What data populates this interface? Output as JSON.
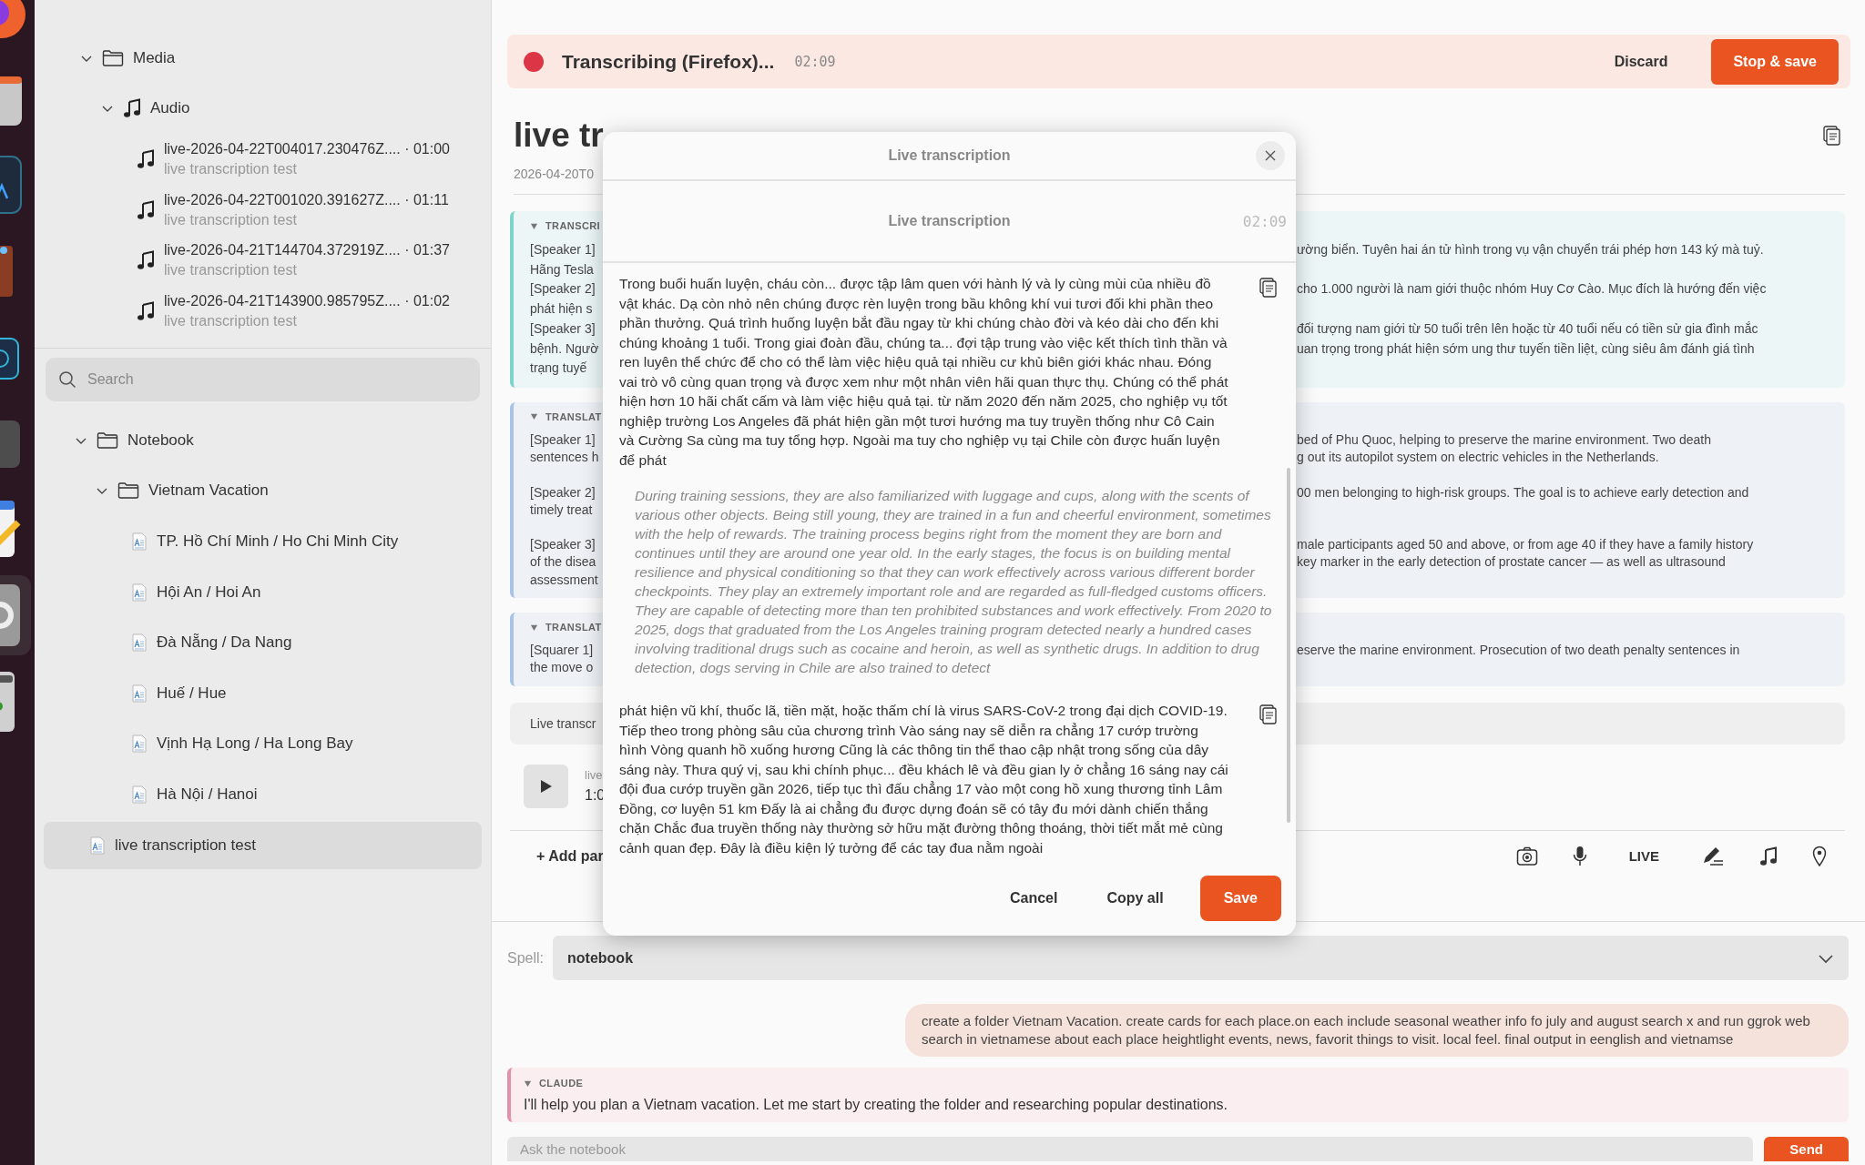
{
  "sidebar": {
    "media": [
      {
        "kind": "folder",
        "label": "Media",
        "expanded": true,
        "selected": false,
        "children": [
          {
            "kind": "audio_folder",
            "label": "Audio",
            "expanded": true,
            "selected": false,
            "children": [
              {
                "kind": "audio",
                "label": "live-2026-04-22T004017.230476Z.... · 01:00",
                "subtitle": "live transcription test",
                "selected": false
              },
              {
                "kind": "audio",
                "label": "live-2026-04-22T001020.391627Z.... · 01:11",
                "subtitle": "live transcription test",
                "selected": false
              },
              {
                "kind": "audio",
                "label": "live-2026-04-21T144704.372919Z.... · 01:37",
                "subtitle": "live transcription test",
                "selected": false
              },
              {
                "kind": "audio",
                "label": "live-2026-04-21T143900.985795Z.... · 01:02",
                "subtitle": "live transcription test",
                "selected": false
              }
            ]
          }
        ]
      }
    ],
    "search": {
      "placeholder": "Search"
    },
    "notes": [
      {
        "kind": "folder",
        "label": "Notebook",
        "expanded": true,
        "selected": false,
        "children": [
          {
            "kind": "folder",
            "label": "Vietnam Vacation",
            "expanded": true,
            "selected": false,
            "children": [
              {
                "kind": "note",
                "label": "TP. Hồ Chí Minh / Ho Chi Minh City",
                "selected": false
              },
              {
                "kind": "note",
                "label": "Hội An / Hoi An",
                "selected": false
              },
              {
                "kind": "note",
                "label": "Đà Nẵng / Da Nang",
                "selected": false
              },
              {
                "kind": "note",
                "label": "Huế / Hue",
                "selected": false
              },
              {
                "kind": "note",
                "label": "Vịnh Hạ Long / Ha Long Bay",
                "selected": false
              },
              {
                "kind": "note",
                "label": "Hà Nội / Hanoi",
                "selected": false
              }
            ]
          }
        ]
      },
      {
        "kind": "note",
        "label": "live transcription test",
        "selected": true
      }
    ]
  },
  "recording_banner": {
    "recording": true,
    "title": "Transcribing (Firefox)...",
    "elapsed": "02:09",
    "discard": "Discard",
    "stop": "Stop & save"
  },
  "note": {
    "title": "live tr",
    "date": "2026-04-20T0",
    "cards": [
      {
        "kind": "transcript",
        "header": "TRANSCRI",
        "expanded": true,
        "paragraphs": [
          [
            {
              "left": "[Speaker 1]",
              "right": "ường biển. Tuyên hai án tử hình trong vụ vận chuyển trái phép hơn 143 ký mà tuỷ."
            },
            {
              "left": "Hãng Tesla"
            },
            {
              "left": "[Speaker 2]",
              "right": "cho 1.000 người là nam giới thuộc nhóm Huy Cơ Cào. Mục đích là hướng đến việc"
            },
            {
              "left": "phát hiện s"
            },
            {
              "left": "[Speaker 3]",
              "right": "đối tượng nam giới từ 50 tuổi trên lên hoặc từ 40 tuổi nếu có tiền sử gia đình mắc"
            },
            {
              "left": "bệnh. Ngườ",
              "right": "uan trọng trong phát hiện sớm ung thư tuyến tiền liệt, cùng siêu âm đánh giá tình"
            },
            {
              "left": "trạng tuyế"
            }
          ]
        ]
      },
      {
        "kind": "translation",
        "header": "TRANSLAT",
        "expanded": true,
        "paragraphs": [
          [
            {
              "left": "[Speaker 1]",
              "right": "bed of Phu Quoc, helping to preserve the marine environment. Two death"
            },
            {
              "left": "sentences h",
              "right": "g out its autopilot system on electric vehicles in the Netherlands."
            }
          ],
          [
            {
              "left": "[Speaker 2]",
              "right": "00 men belonging to high-risk groups. The goal is to achieve early detection and"
            },
            {
              "left": "timely treat"
            }
          ],
          [
            {
              "left": "[Speaker 3]",
              "right": "male participants aged 50 and above, or from age 40 if they have a family history"
            },
            {
              "left": "of the disea",
              "right": "key marker in the early detection of prostate cancer — as well as ultrasound"
            },
            {
              "left": "assessment"
            }
          ]
        ]
      },
      {
        "kind": "translation",
        "header": "TRANSLAT",
        "expanded": true,
        "paragraphs": [
          [
            {
              "left": "[Squarer 1]",
              "right": "eserve the marine environment. Prosecution of two death penalty sentences in"
            },
            {
              "left": "the move o"
            }
          ]
        ]
      }
    ],
    "live_chip": "Live transcr",
    "player": {
      "name": "live",
      "time": "1:0"
    },
    "add_part": "+ Add par",
    "live_label": "LIVE"
  },
  "modal": {
    "title": "Live transcription",
    "subtitle": "Live transcription",
    "elapsed": "02:09",
    "segments": [
      {
        "kind": "original",
        "text": "Trong buổi huấn luyện, cháu còn... được tập lâm quen với hành lý và ly cùng mùi của nhiều đồ vật khác. Dạ còn nhỏ nên chúng được rèn luyện trong bầu không khí vui tươi đối khi phần theo phần thưởng. Quá trình huống luyện bắt đầu ngay từ khi chúng chào đời và kéo dài cho đến khi chúng khoảng 1 tuổi. Trong giai đoàn đầu, chúng ta... đợi tập trung vào việc kết thích tình thần và ren luyên thể chức để cho có thể làm việc hiệu quả tại nhiều cư khủ biên giới khác nhau. Đóng vai trò vô cùng quan trọng và được xem như một nhân viên hãi quan thực thụ. Chúng có thể phát hiện hơn 10 hãi chất cấm và làm việc hiệu quả tại. từ năm 2020 đến năm 2025, cho nghiệp vụ tốt nghiệp trường Los Angeles đã phát hiện gần một tươi hướng ma tuy truyền thống như Cô Cain và Cường Sa cùng ma tuy tổng hợp. Ngoài ma tuy cho nghiệp vụ tại Chile còn được huấn luyện để phát"
      },
      {
        "kind": "translation",
        "text": "During training sessions, they are also familiarized with luggage and cups, along with the scents of various other objects. Being still young, they are trained in a fun and cheerful environment, sometimes with the help of rewards. The training process begins right from the moment they are born and continues until they are around one year old. In the early stages, the focus is on building mental resilience and physical conditioning so that they can work effectively across various different border checkpoints. They play an extremely important role and are regarded as full-fledged customs officers. They are capable of detecting more than ten prohibited substances and work effectively. From 2020 to 2025, dogs that graduated from the Los Angeles training program detected nearly a hundred cases involving traditional drugs such as cocaine and heroin, as well as synthetic drugs. In addition to drug detection, dogs serving in Chile are also trained to detect"
      },
      {
        "kind": "original",
        "text": "phát hiện vũ khí, thuốc lã, tiền mặt, hoặc thấm chí là virus SARS-CoV-2 trong đại dịch COVID-19. Tiếp theo trong phòng sâu của chương trình Vào sáng nay sẽ diễn ra chẳng 17 cướp trường hình Vòng quanh hồ xuống hương Cũng là các thông tin thể thao cập nhật trong sống của dây sáng này. Thưa quý vị, sau khi chính phục... đều khách lê và đều gian ly ở chẳng 16 sáng nay cái đội đua cướp truyền gần 2026, tiếp tục thì đấu chẳng 17 vào một cong hồ xung thương tỉnh Lâm Đồng, cơ luyện 51 km Đấy là ai chẳng đu được dựng đoán sẽ có tây đu mới dành chiến thắng chặn Chắc đua truyền thống này thường sở hữu mặt đường thông thoáng, thời tiết mắt mẻ cùng cảnh quan đẹp. Đây là điều kiện lý tưởng để các tay đua nằm ngoài"
      }
    ],
    "buttons": [
      {
        "kind": "plain",
        "label": "Cancel"
      },
      {
        "kind": "plain",
        "label": "Copy all"
      },
      {
        "kind": "primary",
        "label": "Save"
      }
    ]
  },
  "chat": {
    "spell_label": "Spell:",
    "spell_value": "notebook",
    "messages": [
      {
        "kind": "user",
        "text": "create a folder Vietnam Vacation. create cards for each place.on each include seasonal weather info fo july and august search x and run ggrok web search in vietnamese about each place heightlight events, news, favorit things to visit. local feel. final output in eenglish and vietnamse"
      },
      {
        "kind": "assistant",
        "author": "CLAUDE",
        "expanded": true,
        "text": "I'll help you plan a Vietnam vacation. Let me start by creating the folder and researching popular destinations."
      }
    ],
    "input_placeholder": "Ask the notebook",
    "send": "Send"
  }
}
